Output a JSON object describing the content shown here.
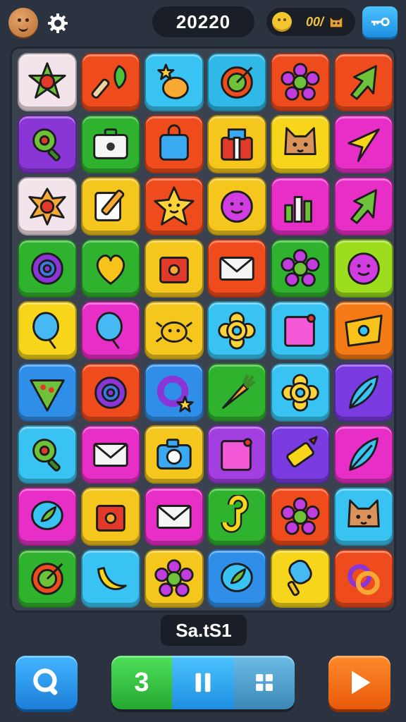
{
  "header": {
    "score": "20220",
    "coins": "00/",
    "avatar_icon": "cookie-face-icon",
    "settings_icon": "gear-icon",
    "menu_icon": "key-icon"
  },
  "board": {
    "rows": [
      [
        {
          "color": "#f3e3ea",
          "icon": "star-flower-icon"
        },
        {
          "color": "#ef4c1d",
          "icon": "paintbrush-leaf-icon"
        },
        {
          "color": "#39c3f2",
          "icon": "onion-star-icon"
        },
        {
          "color": "#2fb8e8",
          "icon": "target-icon"
        },
        {
          "color": "#ef4c1d",
          "icon": "flower-icon"
        },
        {
          "color": "#ef4c1d",
          "icon": "arrow-icon"
        }
      ],
      [
        {
          "color": "#8a35d6",
          "icon": "magnifier-icon"
        },
        {
          "color": "#2fb32e",
          "icon": "briefcase-icon"
        },
        {
          "color": "#ef4c1d",
          "icon": "bag-icon"
        },
        {
          "color": "#f5c61d",
          "icon": "gift-box-icon"
        },
        {
          "color": "#f7d51a",
          "icon": "cat-face-icon"
        },
        {
          "color": "#e72fc8",
          "icon": "kite-icon"
        }
      ],
      [
        {
          "color": "#f3e3ea",
          "icon": "splash-flower-icon"
        },
        {
          "color": "#f5c61d",
          "icon": "pencil-note-icon"
        },
        {
          "color": "#ef4c1d",
          "icon": "smiling-star-icon"
        },
        {
          "color": "#f5c61d",
          "icon": "smiley-ball-icon"
        },
        {
          "color": "#e72fc8",
          "icon": "bar-chart-icon"
        },
        {
          "color": "#e72fc8",
          "icon": "arrow-icon"
        }
      ],
      [
        {
          "color": "#2fb32e",
          "icon": "ring-icon"
        },
        {
          "color": "#2fb32e",
          "icon": "heart-icon"
        },
        {
          "color": "#f5c61d",
          "icon": "house-box-icon"
        },
        {
          "color": "#ef4c1d",
          "icon": "envelope-icon"
        },
        {
          "color": "#2fb32e",
          "icon": "flower-icon"
        },
        {
          "color": "#9cde1e",
          "icon": "smiley-ball-icon"
        }
      ],
      [
        {
          "color": "#f7d51a",
          "icon": "balloon-icon"
        },
        {
          "color": "#e72fc8",
          "icon": "balloon-icon"
        },
        {
          "color": "#f5c61d",
          "icon": "bone-bug-icon"
        },
        {
          "color": "#39c3f2",
          "icon": "donut-flower-icon"
        },
        {
          "color": "#39c3f2",
          "icon": "sticky-note-icon"
        },
        {
          "color": "#f47a16",
          "icon": "ticket-eye-icon"
        }
      ],
      [
        {
          "color": "#2f8fe8",
          "icon": "pizza-slice-icon"
        },
        {
          "color": "#ef4c1d",
          "icon": "ring-icon"
        },
        {
          "color": "#2f8fe8",
          "icon": "ring-star-icon"
        },
        {
          "color": "#2fb32e",
          "icon": "carrot-broom-icon"
        },
        {
          "color": "#39c3f2",
          "icon": "donut-flower-icon"
        },
        {
          "color": "#7a3be0",
          "icon": "feather-icon"
        }
      ],
      [
        {
          "color": "#39c3f2",
          "icon": "magnifier-icon"
        },
        {
          "color": "#e72fc8",
          "icon": "envelope-icon"
        },
        {
          "color": "#f5c61d",
          "icon": "camera-icon"
        },
        {
          "color": "#a33ee0",
          "icon": "sticky-note-icon"
        },
        {
          "color": "#7a3be0",
          "icon": "crayon-icon"
        },
        {
          "color": "#e72fc8",
          "icon": "feather-icon"
        }
      ],
      [
        {
          "color": "#e72fc8",
          "icon": "leaf-bubble-icon"
        },
        {
          "color": "#f5c61d",
          "icon": "house-box-icon"
        },
        {
          "color": "#e72fc8",
          "icon": "envelope-icon"
        },
        {
          "color": "#2fb32e",
          "icon": "hook-icon"
        },
        {
          "color": "#ef4c1d",
          "icon": "flower-icon"
        },
        {
          "color": "#39c3f2",
          "icon": "cat-face-icon"
        }
      ],
      [
        {
          "color": "#2fb32e",
          "icon": "target-icon"
        },
        {
          "color": "#39c3f2",
          "icon": "banana-icon"
        },
        {
          "color": "#f5c61d",
          "icon": "flower-icon"
        },
        {
          "color": "#2f8fe8",
          "icon": "leaf-bubble-icon"
        },
        {
          "color": "#f7d51a",
          "icon": "popsicle-icon"
        },
        {
          "color": "#ef4c1d",
          "icon": "knot-icon"
        }
      ]
    ]
  },
  "footer": {
    "level_label": "Sa.tS1",
    "moves_count": "3",
    "search_icon": "search-icon",
    "pause_icon": "pause-icon",
    "grid_icon": "grid-icon",
    "play_icon": "play-icon"
  }
}
